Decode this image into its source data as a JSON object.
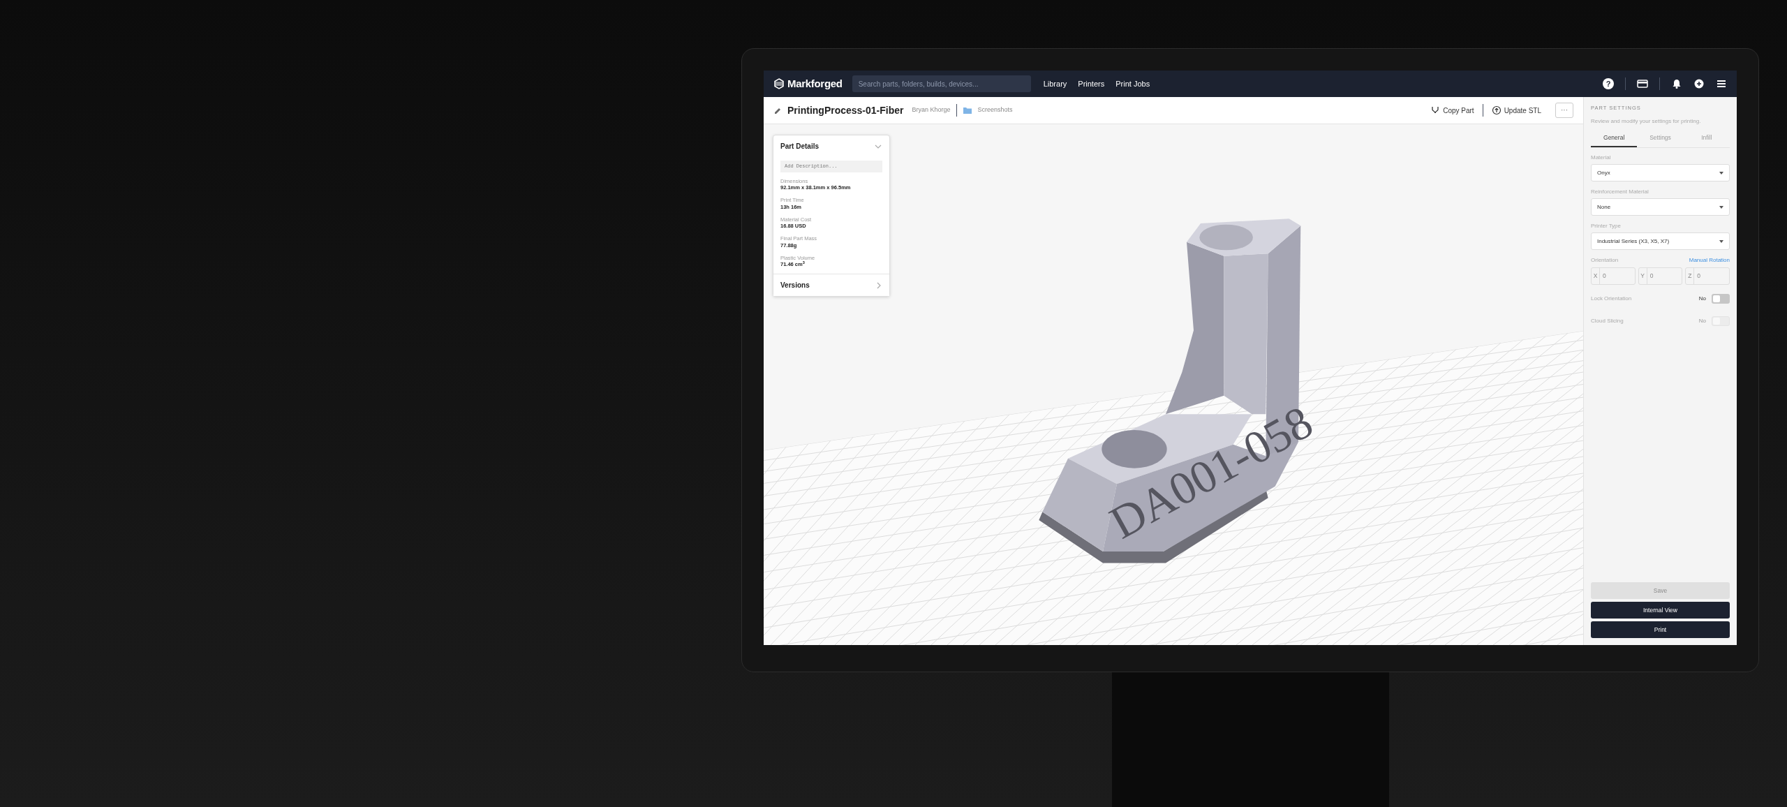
{
  "nav": {
    "brand": "Markforged",
    "search": {
      "placeholder": "Search parts, folders, builds, devices..."
    },
    "links": [
      "Library",
      "Printers",
      "Print Jobs"
    ],
    "help": "?"
  },
  "part_header": {
    "title": "PrintingProcess-01-Fiber",
    "owner": "Bryan Khorge",
    "folder": "Screenshots",
    "actions": [
      {
        "kind": "copy",
        "label": "Copy Part"
      },
      {
        "kind": "upload",
        "label": "Update STL"
      }
    ],
    "more": "···"
  },
  "part_details": {
    "title": "Part Details",
    "expanded": true,
    "description": {
      "placeholder": "Add Description..."
    },
    "fields": [
      {
        "label": "Dimensions",
        "value": "92.1mm x 38.1mm x 96.5mm"
      },
      {
        "label": "Print Time",
        "value": "13h 16m"
      },
      {
        "label": "Material Cost",
        "value": "16.88 USD"
      },
      {
        "label": "Final Part Mass",
        "value": "77.88g"
      },
      {
        "label": "Plastic Volume",
        "value": "71.46 cm$^{3}$"
      }
    ],
    "versions": "Versions"
  },
  "viewport": {
    "engraving": "DA001-058"
  },
  "part_settings": {
    "heading": "PART SETTINGS",
    "subtitle": "Review and modify your settings for printing.",
    "tabs": [
      {
        "label": "General",
        "selected": true
      },
      {
        "label": "Settings",
        "selected": false
      },
      {
        "label": "Infill",
        "selected": false
      }
    ],
    "selects": [
      {
        "label": "Material",
        "value": "Onyx"
      },
      {
        "label": "Reinforcement Material",
        "value": "None"
      },
      {
        "label": "Printer Type",
        "value": "Industrial Series (X3, X5, X7)"
      }
    ],
    "orientation": {
      "label": "Orientation",
      "link": "Manual Rotation",
      "axes": [
        {
          "axis": "X",
          "value": "0"
        },
        {
          "axis": "Y",
          "value": "0"
        },
        {
          "axis": "Z",
          "value": "0"
        }
      ]
    },
    "toggles": [
      {
        "label": "Lock Orientation",
        "state": "No",
        "on": false,
        "disabled": false
      },
      {
        "label": "Cloud Slicing",
        "state": "No",
        "on": false,
        "disabled": true
      }
    ],
    "buttons": [
      {
        "label": "Save",
        "disabled": true
      },
      {
        "label": "Internal View",
        "disabled": false
      },
      {
        "label": "Print",
        "disabled": false
      }
    ]
  }
}
